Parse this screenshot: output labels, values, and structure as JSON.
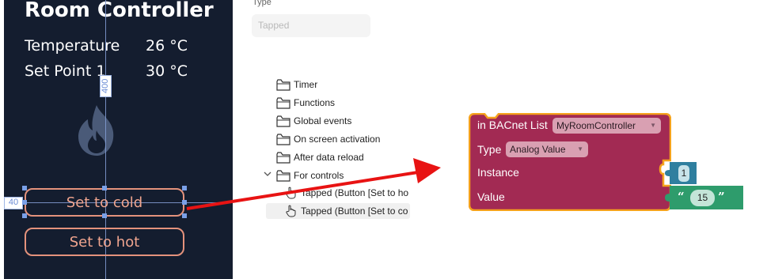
{
  "preview": {
    "title": "Room Controller",
    "rows": [
      {
        "label": "Temperature",
        "value": "26 °C"
      },
      {
        "label": "Set Point 1",
        "value": "30 °C"
      }
    ],
    "dimension_vertical": "400",
    "dimension_horizontal": "40",
    "buttons": {
      "cold": "Set to cold",
      "hot": "Set to hot"
    }
  },
  "type_field": {
    "label": "Type",
    "value": "Tapped"
  },
  "tree": {
    "items": [
      {
        "label": "Timer"
      },
      {
        "label": "Functions"
      },
      {
        "label": "Global events"
      },
      {
        "label": "On screen activation"
      },
      {
        "label": "After data reload"
      },
      {
        "label": "For controls"
      }
    ],
    "children": [
      {
        "label": "Tapped (Button [Set to ho"
      },
      {
        "label": "Tapped (Button [Set to co"
      }
    ]
  },
  "block": {
    "header_prefix": "in BACnet List",
    "list_name": "MyRoomController",
    "type_label": "Type",
    "type_value": "Analog Value",
    "instance_label": "Instance",
    "instance_value": "1",
    "value_label": "Value",
    "value_value": "15",
    "quote_open": "“",
    "quote_close": "”"
  },
  "colors": {
    "preview_background": "#141d2f",
    "button_accent": "#e4927c",
    "block_fill": "#a22a53",
    "block_outline": "#f5a21d",
    "number_block": "#2f7f9f",
    "text_block": "#2e9c6c",
    "arrow": "#e81313"
  },
  "icons": {
    "folder": "folder-icon",
    "hand": "hand-pointer-icon",
    "flame": "flame-icon",
    "chevron": "chevron-down-icon"
  }
}
